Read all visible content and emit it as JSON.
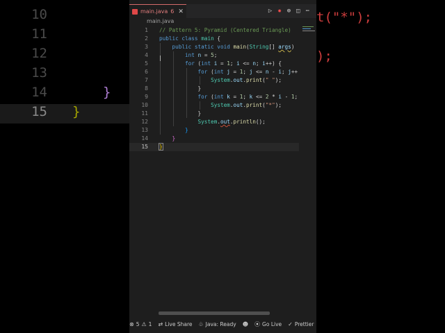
{
  "background": {
    "left_lines": [
      {
        "num": "10",
        "text": ""
      },
      {
        "num": "11",
        "text": ""
      },
      {
        "num": "12",
        "text": ""
      },
      {
        "num": "13",
        "text": ""
      },
      {
        "num": "14",
        "text": "}"
      },
      {
        "num": "15",
        "text": "}"
      }
    ],
    "right_snippets": [
      "t(\"*\");",
      ");"
    ]
  },
  "tab": {
    "filename": "main.java",
    "problems_badge": "6",
    "close_glyph": "✕"
  },
  "toolbar": {
    "run_glyph": "▷",
    "more_glyph": "⋯"
  },
  "breadcrumb": {
    "file": "main.java"
  },
  "code": {
    "line_numbers": [
      "1",
      "2",
      "3",
      "4",
      "5",
      "6",
      "7",
      "8",
      "9",
      "10",
      "11",
      "12",
      "13",
      "14",
      "15"
    ],
    "current_line": "15"
  },
  "statusbar": {
    "errors": "5",
    "warnings": "1",
    "live_share": "Live Share",
    "java_status": "Java: Ready",
    "go_live": "Go Live",
    "prettier": "Prettier"
  },
  "colors": {
    "editor_bg": "#1e1e1e",
    "keyword": "#569cd6",
    "type": "#4ec9b0",
    "function": "#dcdcaa",
    "comment": "#6a9955",
    "tab_error": "#e27d7d"
  }
}
